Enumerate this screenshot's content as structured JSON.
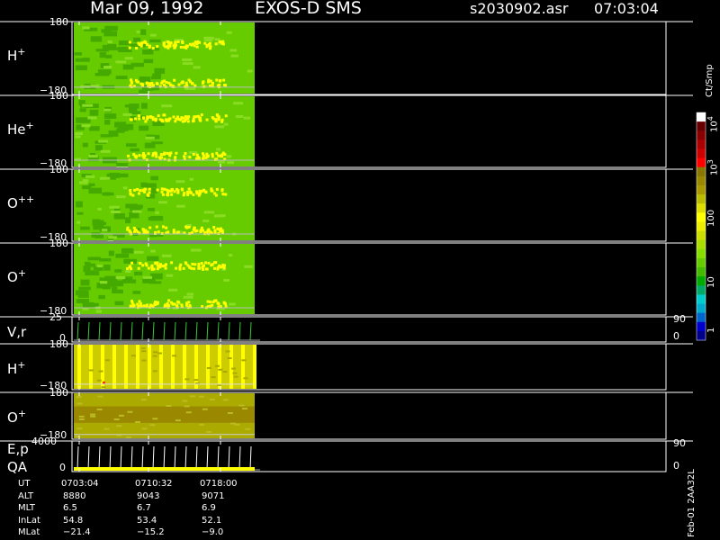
{
  "header": {
    "date": "Mar 09, 1992",
    "instrument": "EXOS-D SMS",
    "file": "s2030902.asr",
    "time": "07:03:04"
  },
  "colors": {
    "background": "#000000",
    "frame": "#ffffff",
    "green": "#66cc00",
    "dark_green": "#44aa00",
    "light_green": "#88dd22",
    "yellow": "#ffff00",
    "olive": "#aaaa00",
    "dark_olive": "#888800",
    "line_green": "#33cc33"
  },
  "chart_data": {
    "type": "heatmap",
    "panels": [
      {
        "label": "H",
        "sup": "+",
        "ymax": "180",
        "ymin": "−180",
        "kind": "angle-green",
        "seed": 1
      },
      {
        "label": "He",
        "sup": "+",
        "ymax": "180",
        "ymin": "−180",
        "kind": "angle-green",
        "seed": 2
      },
      {
        "label": "O",
        "sup": "++",
        "ymax": "180",
        "ymin": "−180",
        "kind": "angle-green",
        "seed": 3
      },
      {
        "label": "O",
        "sup": "+",
        "ymax": "180",
        "ymin": "−180",
        "kind": "angle-green",
        "seed": 4
      },
      {
        "label": "V,r",
        "sup": "",
        "ymax": "25",
        "ymin": "0",
        "right_max": "90",
        "right_min": "0",
        "kind": "line"
      },
      {
        "label": "H",
        "sup": "+",
        "ymax": "180",
        "ymin": "−180",
        "kind": "yellow-striped",
        "seed": 5
      },
      {
        "label": "O",
        "sup": "+",
        "ymax": "180",
        "ymin": "−180",
        "kind": "olive",
        "seed": 6
      },
      {
        "label": "E,p",
        "label2": "QA",
        "sup": "",
        "ymax": "4000",
        "ymin": "0",
        "right_max": "90",
        "right_min": "0",
        "kind": "line-white"
      }
    ],
    "colorbar": {
      "title": "Ct/Smp",
      "ticks": [
        "1",
        "10",
        "100",
        "10",
        "10"
      ],
      "tick_sups": [
        "",
        "",
        "",
        "3",
        "4"
      ],
      "colors": [
        "#000088",
        "#0000cc",
        "#0066cc",
        "#00aacc",
        "#00cccc",
        "#00aa66",
        "#00aa00",
        "#44bb00",
        "#66cc00",
        "#88dd00",
        "#aadd00",
        "#ccdd00",
        "#eeee00",
        "#ffff00",
        "#dddd00",
        "#bbbb00",
        "#aa9900",
        "#998800",
        "#887700",
        "#ff0000",
        "#cc0000",
        "#aa0000",
        "#880000",
        "#660000",
        "#ffffff"
      ]
    },
    "x_axis": {
      "rows": [
        {
          "name": "UT",
          "values": [
            "0703:04",
            "0710:32",
            "0718:00"
          ]
        },
        {
          "name": "ALT",
          "values": [
            "8880",
            "9043",
            "9071"
          ]
        },
        {
          "name": "MLT",
          "values": [
            "6.5",
            "6.7",
            "6.9"
          ]
        },
        {
          "name": "InLat",
          "values": [
            "54.8",
            "53.4",
            "52.1"
          ]
        },
        {
          "name": "MLat",
          "values": [
            "−21.4",
            "−15.2",
            "−9.0"
          ]
        }
      ]
    },
    "footer_vertical": "Feb-01 2AA32L"
  }
}
